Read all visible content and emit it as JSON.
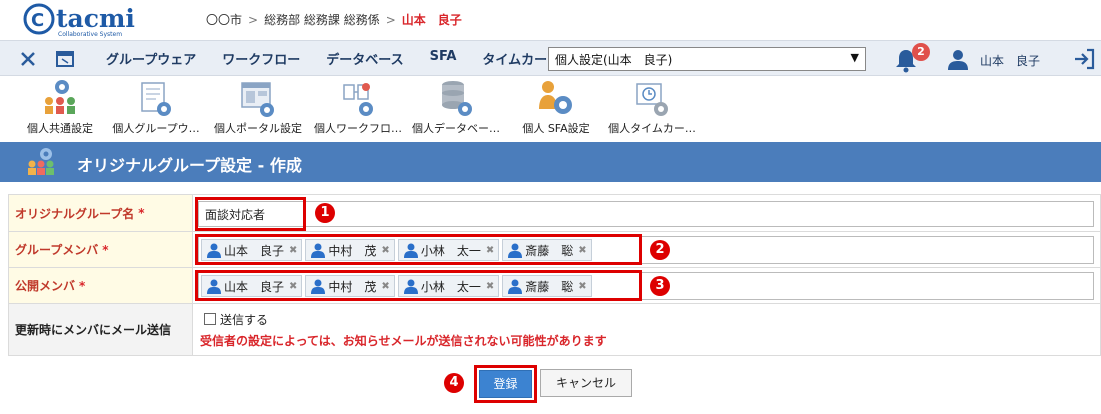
{
  "app": {
    "logo_text": "tacmi",
    "logo_sub": "Collaborative System"
  },
  "breadcrumb": {
    "city": "〇〇市",
    "dept": "総務部 総務課 総務係",
    "user": "山本　良子"
  },
  "nav": {
    "items": [
      "グループウェア",
      "ワークフロー",
      "データベース",
      "SFA",
      "タイムカー"
    ],
    "select_value": "個人設定(山本　良子)",
    "notification_count": "2",
    "user_name": "山本　良子"
  },
  "toolbar": {
    "items": [
      {
        "label": "個人共通設定",
        "icon": "people-gear-icon"
      },
      {
        "label": "個人グループウ…",
        "icon": "groupware-gear-icon"
      },
      {
        "label": "個人ポータル設定",
        "icon": "portal-gear-icon"
      },
      {
        "label": "個人ワークフロ…",
        "icon": "workflow-gear-icon"
      },
      {
        "label": "個人データベー…",
        "icon": "database-gear-icon"
      },
      {
        "label": "個人 SFA設定",
        "icon": "sfa-gear-icon"
      },
      {
        "label": "個人タイムカー…",
        "icon": "timecard-gear-icon"
      }
    ]
  },
  "page": {
    "title": "オリジナルグループ設定 - 作成"
  },
  "form": {
    "group_name": {
      "label": "オリジナルグループ名",
      "required": "*",
      "value": "面談対応者"
    },
    "members": {
      "label": "グループメンバ",
      "required": "*",
      "chips": [
        "山本　良子",
        "中村　茂",
        "小林　太一",
        "斎藤　聡"
      ]
    },
    "public_members": {
      "label": "公開メンバ",
      "required": "*",
      "chips": [
        "山本　良子",
        "中村　茂",
        "小林　太一",
        "斎藤　聡"
      ]
    },
    "notify": {
      "label": "更新時にメンバにメール送信",
      "checkbox_label": "送信する",
      "warning": "受信者の設定によっては、お知らせメールが送信されない可能性があります"
    }
  },
  "buttons": {
    "submit": "登録",
    "cancel": "キャンセル"
  },
  "annotations": [
    "1",
    "2",
    "3",
    "4"
  ],
  "colors": {
    "accent": "#4b7dbb",
    "required": "#d9262b",
    "annotation": "#dd0000"
  }
}
